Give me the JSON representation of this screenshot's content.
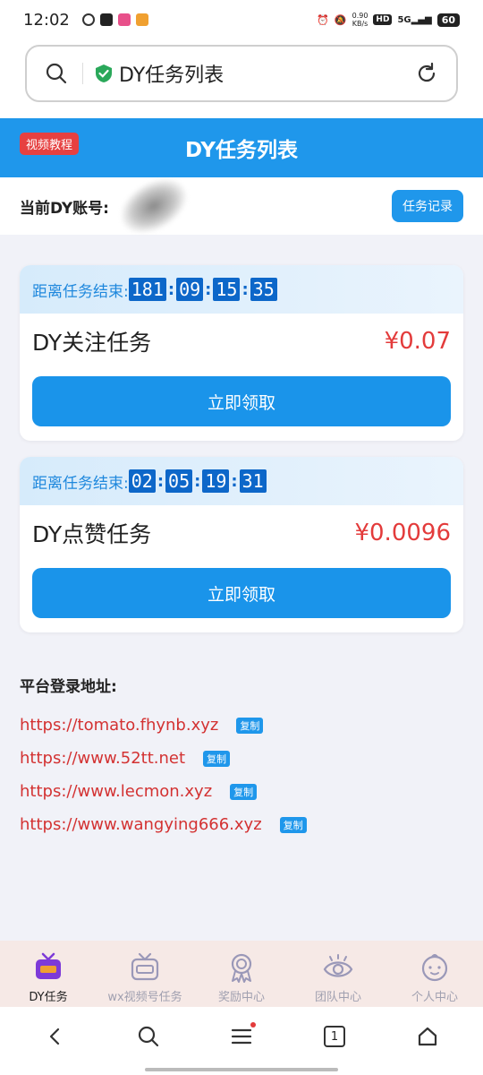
{
  "status_bar": {
    "time": "12:02",
    "net_speed_value": "0.90",
    "net_speed_unit": "KB/s",
    "hd_badge": "HD",
    "signal_label": "5G",
    "battery": "60"
  },
  "browser": {
    "page_title": "DY任务列表"
  },
  "header": {
    "video_tag": "视频教程",
    "title": "DY任务列表"
  },
  "account": {
    "label": "当前DY账号:",
    "record_button": "任务记录"
  },
  "tasks": [
    {
      "countdown_label": "距离任务结束:",
      "countdown": [
        "181",
        "09",
        "15",
        "35"
      ],
      "name": "DY关注任务",
      "price": "¥0.07",
      "button": "立即领取"
    },
    {
      "countdown_label": "距离任务结束:",
      "countdown": [
        "02",
        "05",
        "19",
        "31"
      ],
      "name": "DY点赞任务",
      "price": "¥0.0096",
      "button": "立即领取"
    }
  ],
  "platform": {
    "title": "平台登录地址:",
    "copy_label": "复制",
    "links": [
      "https://tomato.fhynb.xyz",
      "https://www.52tt.net",
      "https://www.lecmon.xyz",
      "https://www.wangying666.xyz"
    ]
  },
  "tabbar": {
    "items": [
      {
        "label": "DY任务",
        "icon": "tv-icon",
        "active": true
      },
      {
        "label": "wx视频号任务",
        "icon": "tv-outline-icon",
        "active": false
      },
      {
        "label": "奖励中心",
        "icon": "medal-icon",
        "active": false
      },
      {
        "label": "团队中心",
        "icon": "eye-icon",
        "active": false
      },
      {
        "label": "个人中心",
        "icon": "face-icon",
        "active": false
      }
    ]
  },
  "navbar": {
    "tab_count": "1"
  },
  "colors": {
    "primary": "#1f97eb",
    "price_red": "#e33b3b",
    "tag_red": "#e64040",
    "countdown_box": "#0d67c9"
  }
}
